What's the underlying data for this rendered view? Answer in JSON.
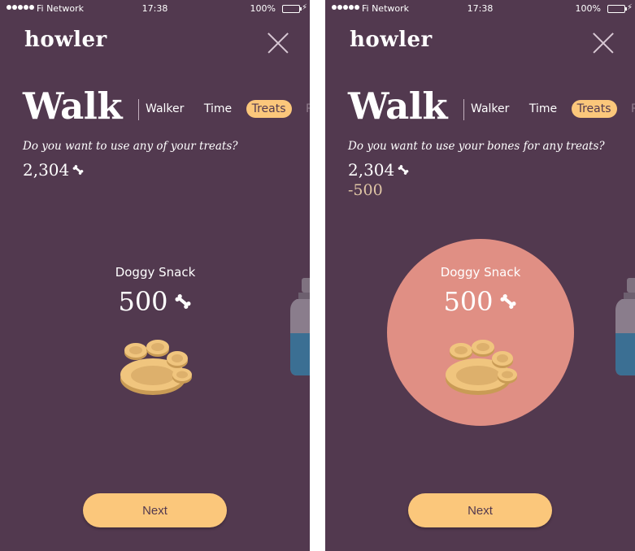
{
  "status": {
    "carrier": "Fi Network",
    "time": "17:38",
    "battery": "100%",
    "battery_level": 1.0
  },
  "app": {
    "name": "howler"
  },
  "colors": {
    "background": "#52394f",
    "accent": "#fbc77b",
    "selection": "#e08f84",
    "treat": "#eec47a"
  },
  "screens": [
    {
      "title": "Walk",
      "tabs": [
        "Walker",
        "Time",
        "Treats",
        "Re"
      ],
      "active_tab": "Treats",
      "question": "Do you want to use any of your treats?",
      "balance": "2,304",
      "deduction": "",
      "item": {
        "name": "Doggy Snack",
        "price": "500"
      },
      "next_label": "Next"
    },
    {
      "title": "Walk",
      "tabs": [
        "Walker",
        "Time",
        "Treats",
        "Re"
      ],
      "active_tab": "Treats",
      "question": "Do you want to use your bones for any treats?",
      "balance": "2,304",
      "deduction": "-500",
      "item": {
        "name": "Doggy Snack",
        "price": "500"
      },
      "next_label": "Next"
    }
  ]
}
